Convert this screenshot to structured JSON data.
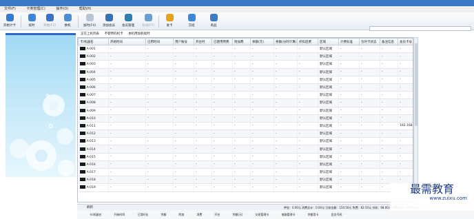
{
  "menu": [
    "文件(F)",
    "卡类管理(C)",
    "操作(O)",
    "帮助(H)"
  ],
  "toolbar": {
    "buttons": [
      {
        "label": "开始计卡",
        "icon": "start-icon",
        "color": "#2f7bd6",
        "disabled": false
      },
      {
        "label": "续时",
        "icon": "arrow-icon",
        "color": "#3b86d8",
        "disabled": false
      },
      {
        "label": "开始(F2)",
        "icon": "circle-icon",
        "color": "#3a72c8",
        "disabled": true
      },
      {
        "label": "换机",
        "icon": "refresh-icon",
        "color": "#4a8fd6",
        "disabled": false
      },
      {
        "label": "加时(F4)",
        "icon": "clock-icon",
        "color": "#b7c6d6",
        "disabled": false
      },
      {
        "label": "添加会员",
        "icon": "user-add-icon",
        "color": "#3672b8",
        "disabled": false
      },
      {
        "label": "会员管理",
        "icon": "users-icon",
        "color": "#2e7fb0",
        "disabled": false
      },
      {
        "label": "包间(F7)",
        "icon": "monitor-icon",
        "color": "#6b9fd0",
        "disabled": true
      },
      {
        "label": "发卡",
        "icon": "card-icon",
        "color": "#e5a21c",
        "disabled": false
      },
      {
        "label": "交班",
        "icon": "sync-icon",
        "color": "#3b86d8",
        "disabled": false
      },
      {
        "label": "商品",
        "icon": "cart-icon",
        "color": "#3a7fc6",
        "disabled": false
      }
    ]
  },
  "filters": [
    "正在上机列表",
    "不使用的机卡",
    "本机用加机续时"
  ],
  "table": {
    "columns": [
      "卡/机器名",
      "开始时间",
      "已用时间",
      "用户账号",
      "开台时",
      "已使用用费",
      "附加费",
      "余额(元)",
      "余额(分时计算)",
      "折扣后费",
      "区域",
      "计费标准",
      "包时卡状态",
      "备注信息",
      "会员卡号"
    ],
    "rows": [
      [
        "A-001",
        "-",
        "-",
        "-",
        "-",
        "-",
        "-",
        "-",
        "-",
        "-",
        "默认区域",
        "-",
        "-",
        "-",
        "-"
      ],
      [
        "A-002",
        "-",
        "-",
        "-",
        "-",
        "-",
        "-",
        "-",
        "-",
        "-",
        "默认区域",
        "-",
        "-",
        "-",
        "-"
      ],
      [
        "A-003",
        "-",
        "-",
        "-",
        "-",
        "-",
        "-",
        "-",
        "-",
        "-",
        "默认区域",
        "-",
        "-",
        "-",
        "-"
      ],
      [
        "A-004",
        "-",
        "-",
        "-",
        "-",
        "-",
        "-",
        "-",
        "-",
        "-",
        "默认区域",
        "-",
        "-",
        "-",
        "-"
      ],
      [
        "A-005",
        "-",
        "-",
        "-",
        "-",
        "-",
        "-",
        "-",
        "-",
        "-",
        "默认区域",
        "-",
        "-",
        "-",
        "-"
      ],
      [
        "A-006",
        "-",
        "-",
        "-",
        "-",
        "-",
        "-",
        "-",
        "-",
        "-",
        "默认区域",
        "-",
        "-",
        "-",
        "-"
      ],
      [
        "A-007",
        "-",
        "-",
        "-",
        "-",
        "-",
        "-",
        "-",
        "-",
        "-",
        "默认区域",
        "-",
        "-",
        "-",
        "-"
      ],
      [
        "A-008",
        "-",
        "-",
        "-",
        "-",
        "-",
        "-",
        "-",
        "-",
        "-",
        "默认区域",
        "-",
        "-",
        "-",
        "-"
      ],
      [
        "A-009",
        "-",
        "-",
        "-",
        "-",
        "-",
        "-",
        "-",
        "-",
        "-",
        "默认区域",
        "-",
        "-",
        "-",
        "-"
      ],
      [
        "A-010",
        "-",
        "-",
        "-",
        "-",
        "-",
        "-",
        "-",
        "-",
        "-",
        "默认区域",
        "-",
        "-",
        "-",
        "-"
      ],
      [
        "A-011",
        "-",
        "-",
        "-",
        "-",
        "-",
        "-",
        "-",
        "-",
        "-",
        "默认区域",
        "-",
        "-",
        "-",
        "192.168.3.123"
      ],
      [
        "A-012",
        "-",
        "-",
        "-",
        "-",
        "-",
        "-",
        "-",
        "-",
        "-",
        "默认区域",
        "-",
        "-",
        "-",
        "-"
      ],
      [
        "A-013",
        "-",
        "-",
        "-",
        "-",
        "-",
        "-",
        "-",
        "-",
        "-",
        "默认区域",
        "-",
        "-",
        "-",
        "-"
      ],
      [
        "A-014",
        "-",
        "-",
        "-",
        "-",
        "-",
        "-",
        "-",
        "-",
        "-",
        "默认区域",
        "-",
        "-",
        "-",
        "-"
      ],
      [
        "A-015",
        "-",
        "-",
        "-",
        "-",
        "-",
        "-",
        "-",
        "-",
        "-",
        "默认区域",
        "-",
        "-",
        "-",
        "-"
      ],
      [
        "A-016",
        "-",
        "-",
        "-",
        "-",
        "-",
        "-",
        "-",
        "-",
        "-",
        "默认区域",
        "-",
        "-",
        "-",
        "-"
      ],
      [
        "A-017",
        "-",
        "-",
        "-",
        "-",
        "-",
        "-",
        "-",
        "-",
        "-",
        "默认区域",
        "-",
        "-",
        "-",
        "-"
      ],
      [
        "A-018",
        "-",
        "-",
        "-",
        "-",
        "-",
        "-",
        "-",
        "-",
        "-",
        "默认区域",
        "-",
        "-",
        "-",
        "-"
      ],
      [
        "A-019",
        "-",
        "-",
        "-",
        "-",
        "-",
        "-",
        "-",
        "-",
        "-",
        "默认区域",
        "-",
        "-",
        "-",
        "-"
      ]
    ]
  },
  "status": {
    "left": "刷新",
    "right": "押金：0.00元  消费总计：0.00元  已收金额：150.50元  免费：82.50元  另收：68.00元  扣费总额：174.00元"
  },
  "bottom_columns": [
    "卡/机器名",
    "开始时间",
    "已用时长",
    "余额",
    "附加",
    "消费",
    "开台",
    "余额(元)",
    "交班管理卡",
    "电脑管理卡",
    "余额用卡",
    "会员号码"
  ],
  "watermark": {
    "text": "最需教育",
    "url": "www.zuixu.com"
  },
  "colors": {
    "accent": "#2a66c2",
    "title_bar": "#3a78c8"
  }
}
